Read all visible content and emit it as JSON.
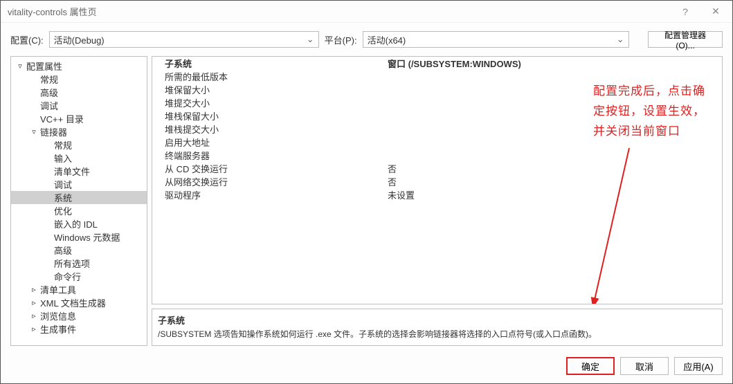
{
  "window": {
    "title": "vitality-controls 属性页"
  },
  "config": {
    "config_label": "配置(C):",
    "config_value": "活动(Debug)",
    "platform_label": "平台(P):",
    "platform_value": "活动(x64)",
    "manager_button": "配置管理器(O)..."
  },
  "tree": [
    {
      "label": "配置属性",
      "depth": 0,
      "expand": "▿"
    },
    {
      "label": "常规",
      "depth": 1
    },
    {
      "label": "高级",
      "depth": 1
    },
    {
      "label": "调试",
      "depth": 1
    },
    {
      "label": "VC++ 目录",
      "depth": 1
    },
    {
      "label": "链接器",
      "depth": 1,
      "expand": "▿"
    },
    {
      "label": "常规",
      "depth": 2
    },
    {
      "label": "输入",
      "depth": 2
    },
    {
      "label": "清单文件",
      "depth": 2
    },
    {
      "label": "调试",
      "depth": 2
    },
    {
      "label": "系统",
      "depth": 2,
      "selected": true
    },
    {
      "label": "优化",
      "depth": 2
    },
    {
      "label": "嵌入的 IDL",
      "depth": 2
    },
    {
      "label": "Windows 元数据",
      "depth": 2
    },
    {
      "label": "高级",
      "depth": 2
    },
    {
      "label": "所有选项",
      "depth": 2
    },
    {
      "label": "命令行",
      "depth": 2
    },
    {
      "label": "清单工具",
      "depth": 1,
      "expand": "▹"
    },
    {
      "label": "XML 文档生成器",
      "depth": 1,
      "expand": "▹"
    },
    {
      "label": "浏览信息",
      "depth": 1,
      "expand": "▹"
    },
    {
      "label": "生成事件",
      "depth": 1,
      "expand": "▹"
    }
  ],
  "props": [
    {
      "key": "子系统",
      "value": "窗口 (/SUBSYSTEM:WINDOWS)",
      "highlight": true
    },
    {
      "key": "所需的最低版本",
      "value": ""
    },
    {
      "key": "堆保留大小",
      "value": ""
    },
    {
      "key": "堆提交大小",
      "value": ""
    },
    {
      "key": "堆栈保留大小",
      "value": ""
    },
    {
      "key": "堆栈提交大小",
      "value": ""
    },
    {
      "key": "启用大地址",
      "value": ""
    },
    {
      "key": "终端服务器",
      "value": ""
    },
    {
      "key": "从 CD 交换运行",
      "value": "否"
    },
    {
      "key": "从网络交换运行",
      "value": "否"
    },
    {
      "key": "驱动程序",
      "value": "未设置"
    }
  ],
  "desc": {
    "title": "子系统",
    "body": "/SUBSYSTEM 选项告知操作系统如何运行 .exe 文件。子系统的选择会影响链接器将选择的入口点符号(或入口点函数)。"
  },
  "buttons": {
    "ok": "确定",
    "cancel": "取消",
    "apply": "应用(A)"
  },
  "annotation": {
    "line1": "配置完成后，点击确",
    "line2": "定按钮，设置生效，",
    "line3": "并关闭当前窗口"
  }
}
